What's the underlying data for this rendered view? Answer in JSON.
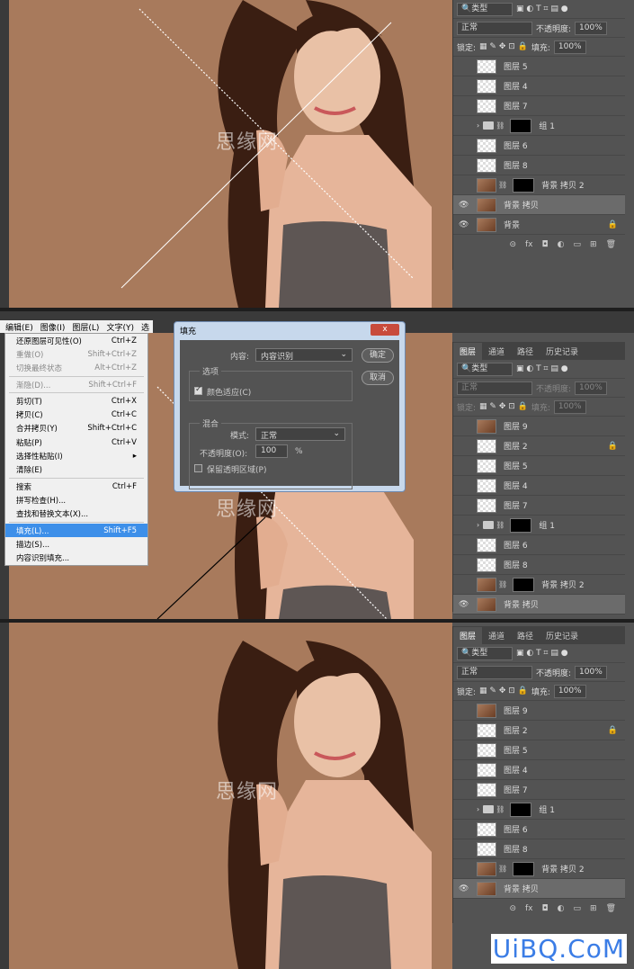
{
  "layers_panel": {
    "tabs": [
      "图层",
      "通道",
      "路径",
      "历史记录"
    ],
    "kind_label": "类型",
    "blend_mode": "正常",
    "opacity_label": "不透明度:",
    "opacity_value": "100%",
    "lock_label": "锁定:",
    "fill_label": "填充:",
    "fill_value": "100%",
    "layers": [
      {
        "name": "图层 9",
        "thumb": "photo"
      },
      {
        "name": "图层 2",
        "thumb": "check",
        "lock": true
      },
      {
        "name": "图层 5",
        "thumb": "check"
      },
      {
        "name": "图层 4",
        "thumb": "check"
      },
      {
        "name": "图层 7",
        "thumb": "check"
      },
      {
        "name": "组 1",
        "thumb": "group"
      },
      {
        "name": "图层 6",
        "thumb": "check"
      },
      {
        "name": "图层 8",
        "thumb": "check"
      },
      {
        "name": "背景 拷贝 2",
        "thumb": "photo-mask"
      },
      {
        "name": "背景 拷贝",
        "thumb": "photo",
        "selected": true
      },
      {
        "name": "背景",
        "thumb": "photo",
        "lock": true
      }
    ]
  },
  "menubar": [
    "编辑(E)",
    "图像(I)",
    "图层(L)",
    "文字(Y)",
    "选"
  ],
  "edit_menu": [
    {
      "label": "还原图层可见性(O)",
      "shortcut": "Ctrl+Z"
    },
    {
      "label": "重做(O)",
      "shortcut": "Shift+Ctrl+Z",
      "disabled": true
    },
    {
      "label": "切换最终状态",
      "shortcut": "Alt+Ctrl+Z",
      "disabled": true
    },
    {
      "sep": true
    },
    {
      "label": "渐隐(D)...",
      "shortcut": "Shift+Ctrl+F",
      "disabled": true
    },
    {
      "sep": true
    },
    {
      "label": "剪切(T)",
      "shortcut": "Ctrl+X"
    },
    {
      "label": "拷贝(C)",
      "shortcut": "Ctrl+C"
    },
    {
      "label": "合并拷贝(Y)",
      "shortcut": "Shift+Ctrl+C"
    },
    {
      "label": "粘贴(P)",
      "shortcut": "Ctrl+V"
    },
    {
      "label": "选择性粘贴(I)",
      "shortcut": "▸"
    },
    {
      "label": "清除(E)",
      "shortcut": ""
    },
    {
      "sep": true
    },
    {
      "label": "搜索",
      "shortcut": "Ctrl+F"
    },
    {
      "label": "拼写检查(H)...",
      "shortcut": ""
    },
    {
      "label": "查找和替换文本(X)...",
      "shortcut": ""
    },
    {
      "sep": true
    },
    {
      "label": "填充(L)...",
      "shortcut": "Shift+F5",
      "highlight": true
    },
    {
      "label": "描边(S)...",
      "shortcut": ""
    },
    {
      "label": "内容识别填充...",
      "shortcut": ""
    }
  ],
  "fill_dialog": {
    "title": "填充",
    "close": "x",
    "content_label": "内容:",
    "content_value": "内容识别",
    "ok": "确定",
    "cancel": "取消",
    "options_label": "选项",
    "color_adapt": "颜色适应(C)",
    "blend_label": "混合",
    "mode_label": "模式:",
    "mode_value": "正常",
    "opacity_label": "不透明度(O):",
    "opacity_value": "100",
    "opacity_unit": "%",
    "preserve": "保留透明区域(P)"
  },
  "watermark": "思缘网",
  "logo": "UiBQ.CoM"
}
